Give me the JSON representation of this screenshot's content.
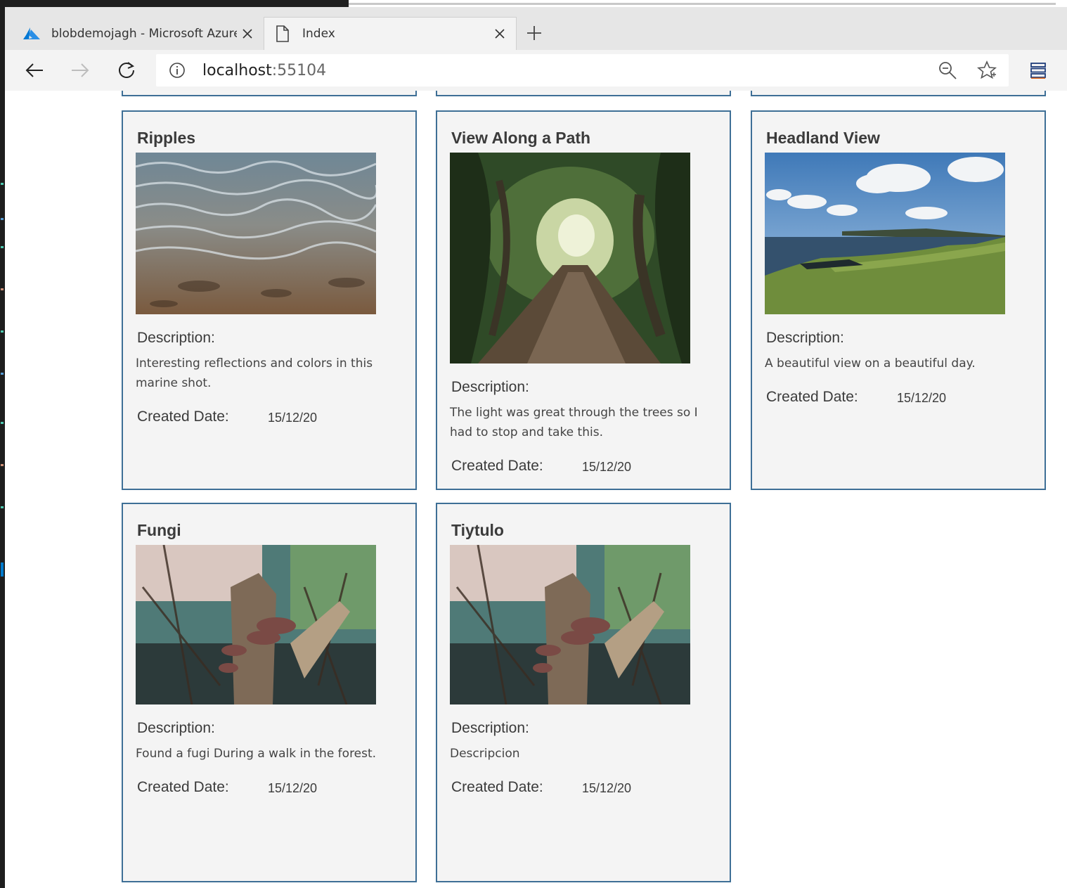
{
  "browser": {
    "tabs": [
      {
        "title": "blobdemojagh - Microsoft Azure",
        "icon": "azure-logo-icon",
        "active": false
      },
      {
        "title": "Index",
        "icon": "page-icon",
        "active": true
      }
    ],
    "address": {
      "host": "localhost",
      "port": ":55104"
    }
  },
  "gallery": {
    "description_label": "Description:",
    "created_label": "Created Date:",
    "items": [
      {
        "title": "Ripples",
        "description": "Interesting reflections and colors in this marine shot.",
        "created": "15/12/20",
        "image": "water-ripples-photo"
      },
      {
        "title": "View Along a Path",
        "description": "The light was great through the trees so I had to stop and take this.",
        "created": "15/12/20",
        "image": "forest-path-photo"
      },
      {
        "title": "Headland View",
        "description": "A beautiful view on a beautiful day.",
        "created": "15/12/20",
        "image": "coastal-headland-photo"
      },
      {
        "title": "Fungi",
        "description": "Found a fugi During a walk in the forest.",
        "created": "15/12/20",
        "image": "fungi-on-stump-photo"
      },
      {
        "title": "Tiytulo",
        "description": "Descripcion",
        "created": "15/12/20",
        "image": "fungi-on-stump-photo"
      }
    ]
  },
  "colors": {
    "card_border": "#3e6f96",
    "card_bg": "#f4f4f4",
    "chrome_bg": "#f3f3f3",
    "azure_blue": "#0078d4"
  }
}
